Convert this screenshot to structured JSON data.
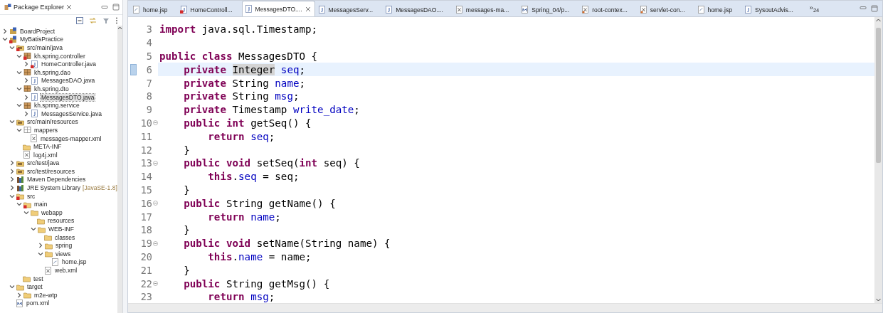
{
  "explorer": {
    "title": "Package Explorer",
    "tree": [
      {
        "label": "BoardProject",
        "kind": "project",
        "expanded": false,
        "selected": false,
        "error": false
      },
      {
        "label": "MyBatisPractice",
        "kind": "project",
        "expanded": true,
        "selected": false,
        "error": true,
        "children": [
          {
            "label": "src/main/java",
            "kind": "source-folder",
            "expanded": true,
            "selected": false,
            "error": true,
            "children": [
              {
                "label": "kh.spring.controller",
                "kind": "package",
                "expanded": true,
                "selected": false,
                "error": true,
                "children": [
                  {
                    "label": "HomeController.java",
                    "kind": "java",
                    "expanded": false,
                    "selected": false,
                    "error": true
                  }
                ]
              },
              {
                "label": "kh.spring.dao",
                "kind": "package",
                "expanded": true,
                "selected": false,
                "error": false,
                "children": [
                  {
                    "label": "MessagesDAO.java",
                    "kind": "java",
                    "expanded": false,
                    "selected": false,
                    "error": false
                  }
                ]
              },
              {
                "label": "kh.spring.dto",
                "kind": "package",
                "expanded": true,
                "selected": false,
                "error": false,
                "children": [
                  {
                    "label": "MessagesDTO.java",
                    "kind": "java",
                    "expanded": false,
                    "selected": true,
                    "error": false
                  }
                ]
              },
              {
                "label": "kh.spring.service",
                "kind": "package",
                "expanded": true,
                "selected": false,
                "error": false,
                "children": [
                  {
                    "label": "MessagesService.java",
                    "kind": "java",
                    "expanded": false,
                    "selected": false,
                    "error": false
                  }
                ]
              }
            ]
          },
          {
            "label": "src/main/resources",
            "kind": "source-folder",
            "expanded": true,
            "selected": false,
            "error": false,
            "children": [
              {
                "label": "mappers",
                "kind": "package-empty",
                "expanded": true,
                "selected": false,
                "error": false,
                "children": [
                  {
                    "label": "messages-mapper.xml",
                    "kind": "xml",
                    "selected": false,
                    "error": false
                  }
                ]
              },
              {
                "label": "META-INF",
                "kind": "folder",
                "selected": false,
                "error": false
              },
              {
                "label": "log4j.xml",
                "kind": "xml",
                "selected": false,
                "error": false
              }
            ]
          },
          {
            "label": "src/test/java",
            "kind": "source-folder",
            "expanded": false,
            "selected": false,
            "error": false
          },
          {
            "label": "src/test/resources",
            "kind": "source-folder",
            "expanded": false,
            "selected": false,
            "error": false
          },
          {
            "label": "Maven Dependencies",
            "kind": "library",
            "expanded": false,
            "selected": false,
            "error": false
          },
          {
            "label": "JRE System Library",
            "decoration": "[JavaSE-1.8]",
            "kind": "library",
            "expanded": false,
            "selected": false,
            "error": false
          },
          {
            "label": "src",
            "kind": "folder",
            "expanded": true,
            "selected": false,
            "error": true,
            "children": [
              {
                "label": "main",
                "kind": "folder",
                "expanded": true,
                "selected": false,
                "error": true,
                "children": [
                  {
                    "label": "webapp",
                    "kind": "folder",
                    "expanded": true,
                    "selected": false,
                    "error": false,
                    "children": [
                      {
                        "label": "resources",
                        "kind": "folder",
                        "selected": false,
                        "error": false
                      },
                      {
                        "label": "WEB-INF",
                        "kind": "folder",
                        "expanded": true,
                        "selected": false,
                        "error": false,
                        "children": [
                          {
                            "label": "classes",
                            "kind": "folder",
                            "selected": false,
                            "error": false
                          },
                          {
                            "label": "spring",
                            "kind": "folder",
                            "expanded": false,
                            "selected": false,
                            "error": false
                          },
                          {
                            "label": "views",
                            "kind": "folder",
                            "expanded": true,
                            "selected": false,
                            "error": false,
                            "children": [
                              {
                                "label": "home.jsp",
                                "kind": "jsp",
                                "selected": false,
                                "error": false
                              }
                            ]
                          },
                          {
                            "label": "web.xml",
                            "kind": "xml",
                            "selected": false,
                            "error": false
                          }
                        ]
                      }
                    ]
                  }
                ]
              },
              {
                "label": "test",
                "kind": "folder",
                "selected": false,
                "error": false
              }
            ]
          },
          {
            "label": "target",
            "kind": "folder",
            "expanded": true,
            "selected": false,
            "error": false,
            "children": [
              {
                "label": "m2e-wtp",
                "kind": "folder",
                "expanded": false,
                "selected": false,
                "error": false
              }
            ]
          },
          {
            "label": "pom.xml",
            "kind": "pom",
            "selected": false,
            "error": false
          }
        ]
      }
    ]
  },
  "editor": {
    "tabs": [
      {
        "label": "home.jsp",
        "kind": "jsp",
        "selected": false
      },
      {
        "label": "HomeControll...",
        "kind": "java-error",
        "selected": false
      },
      {
        "label": "MessagesDTO....",
        "kind": "java",
        "selected": true
      },
      {
        "label": "MessagesServ...",
        "kind": "java",
        "selected": false
      },
      {
        "label": "MessagesDAO....",
        "kind": "java",
        "selected": false
      },
      {
        "label": "messages-ma...",
        "kind": "xml",
        "selected": false
      },
      {
        "label": "Spring_04/p...",
        "kind": "pom",
        "selected": false
      },
      {
        "label": "root-contex...",
        "kind": "spring-xml",
        "selected": false
      },
      {
        "label": "servlet-con...",
        "kind": "spring-xml",
        "selected": false
      },
      {
        "label": "home.jsp",
        "kind": "jsp",
        "selected": false
      },
      {
        "label": "SysoutAdvis...",
        "kind": "java",
        "selected": false
      }
    ],
    "overflow": "»$_{24}$",
    "lines": [
      {
        "number": "3",
        "fold": false,
        "current": false,
        "tokens": [
          {
            "kind": "kw",
            "text": "import"
          },
          {
            "kind": "text",
            "text": " java.sql.Timestamp;"
          }
        ]
      },
      {
        "number": "4",
        "fold": false,
        "current": false
      },
      {
        "number": "5",
        "fold": false,
        "current": false,
        "tokens": [
          {
            "kind": "kw",
            "text": "public"
          },
          {
            "kind": "kw",
            "text": " class"
          },
          {
            "kind": "text",
            "text": " MessagesDTO {"
          }
        ]
      },
      {
        "number": "6",
        "fold": false,
        "current": true,
        "tokens": [
          {
            "kind": "kw",
            "text": "    private "
          },
          {
            "kind": "mark",
            "text": "Integer"
          },
          {
            "kind": "field",
            "text": " seq"
          },
          {
            "kind": "text",
            "text": ";"
          }
        ]
      },
      {
        "number": "7",
        "fold": false,
        "current": false,
        "tokens": [
          {
            "kind": "kw",
            "text": "    private"
          },
          {
            "kind": "text",
            "text": " String "
          },
          {
            "kind": "field",
            "text": "name"
          },
          {
            "kind": "text",
            "text": ";"
          }
        ]
      },
      {
        "number": "8",
        "fold": false,
        "current": false,
        "tokens": [
          {
            "kind": "kw",
            "text": "    private"
          },
          {
            "kind": "text",
            "text": " String "
          },
          {
            "kind": "field",
            "text": "msg"
          },
          {
            "kind": "text",
            "text": ";"
          }
        ]
      },
      {
        "number": "9",
        "fold": false,
        "current": false,
        "tokens": [
          {
            "kind": "kw",
            "text": "    private"
          },
          {
            "kind": "text",
            "text": " Timestamp "
          },
          {
            "kind": "field",
            "text": "write_date"
          },
          {
            "kind": "text",
            "text": ";"
          }
        ]
      },
      {
        "number": "10",
        "fold": true,
        "current": false,
        "tokens": [
          {
            "kind": "kw",
            "text": "    public"
          },
          {
            "kind": "kw",
            "text": " int"
          },
          {
            "kind": "text",
            "text": " getSeq() {"
          }
        ]
      },
      {
        "number": "11",
        "fold": false,
        "current": false,
        "tokens": [
          {
            "kind": "kw",
            "text": "        return"
          },
          {
            "kind": "field",
            "text": " seq"
          },
          {
            "kind": "text",
            "text": ";"
          }
        ]
      },
      {
        "number": "12",
        "fold": false,
        "current": false,
        "tokens": [
          {
            "kind": "text",
            "text": "    }"
          }
        ]
      },
      {
        "number": "13",
        "fold": true,
        "current": false,
        "tokens": [
          {
            "kind": "kw",
            "text": "    public"
          },
          {
            "kind": "kw",
            "text": " void"
          },
          {
            "kind": "text",
            "text": " setSeq("
          },
          {
            "kind": "kw",
            "text": "int"
          },
          {
            "kind": "text",
            "text": " seq) {"
          }
        ]
      },
      {
        "number": "14",
        "fold": false,
        "current": false,
        "tokens": [
          {
            "kind": "kw",
            "text": "        this"
          },
          {
            "kind": "text",
            "text": "."
          },
          {
            "kind": "field",
            "text": "seq"
          },
          {
            "kind": "text",
            "text": " = seq;"
          }
        ]
      },
      {
        "number": "15",
        "fold": false,
        "current": false,
        "tokens": [
          {
            "kind": "text",
            "text": "    }"
          }
        ]
      },
      {
        "number": "16",
        "fold": true,
        "current": false,
        "tokens": [
          {
            "kind": "kw",
            "text": "    public"
          },
          {
            "kind": "text",
            "text": " String getName() {"
          }
        ]
      },
      {
        "number": "17",
        "fold": false,
        "current": false,
        "tokens": [
          {
            "kind": "kw",
            "text": "        return"
          },
          {
            "kind": "field",
            "text": " name"
          },
          {
            "kind": "text",
            "text": ";"
          }
        ]
      },
      {
        "number": "18",
        "fold": false,
        "current": false,
        "tokens": [
          {
            "kind": "text",
            "text": "    }"
          }
        ]
      },
      {
        "number": "19",
        "fold": true,
        "current": false,
        "tokens": [
          {
            "kind": "kw",
            "text": "    public"
          },
          {
            "kind": "kw",
            "text": " void"
          },
          {
            "kind": "text",
            "text": " setName(String name) {"
          }
        ]
      },
      {
        "number": "20",
        "fold": false,
        "current": false,
        "tokens": [
          {
            "kind": "kw",
            "text": "        this"
          },
          {
            "kind": "text",
            "text": "."
          },
          {
            "kind": "field",
            "text": "name"
          },
          {
            "kind": "text",
            "text": " = name;"
          }
        ]
      },
      {
        "number": "21",
        "fold": false,
        "current": false,
        "tokens": [
          {
            "kind": "text",
            "text": "    }"
          }
        ]
      },
      {
        "number": "22",
        "fold": true,
        "current": false,
        "tokens": [
          {
            "kind": "kw",
            "text": "    public"
          },
          {
            "kind": "text",
            "text": " String getMsg() {"
          }
        ]
      },
      {
        "number": "23",
        "fold": false,
        "current": false,
        "tokens": [
          {
            "kind": "kw",
            "text": "        return"
          },
          {
            "kind": "field",
            "text": " msg"
          },
          {
            "kind": "text",
            "text": ";"
          }
        ]
      }
    ]
  }
}
